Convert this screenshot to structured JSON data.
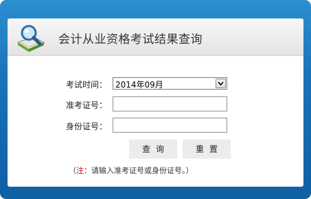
{
  "header": {
    "title": "会计从业资格考试结果查询",
    "logo_icon": "magnifier-book-icon"
  },
  "form": {
    "exam_time_label": "考试时间：",
    "exam_time_value": "2014年09月",
    "ticket_label": "准考证号：",
    "ticket_value": "",
    "id_label": "身份证号：",
    "id_value": ""
  },
  "buttons": {
    "query_label": "查询",
    "reset_label": "重置"
  },
  "note": {
    "open": "（",
    "prefix": "注：",
    "text": "请输入准考证号或身份证号。",
    "close": "）"
  },
  "colors": {
    "frame_blue": "#1a72b8",
    "note_red": "#d40000"
  }
}
